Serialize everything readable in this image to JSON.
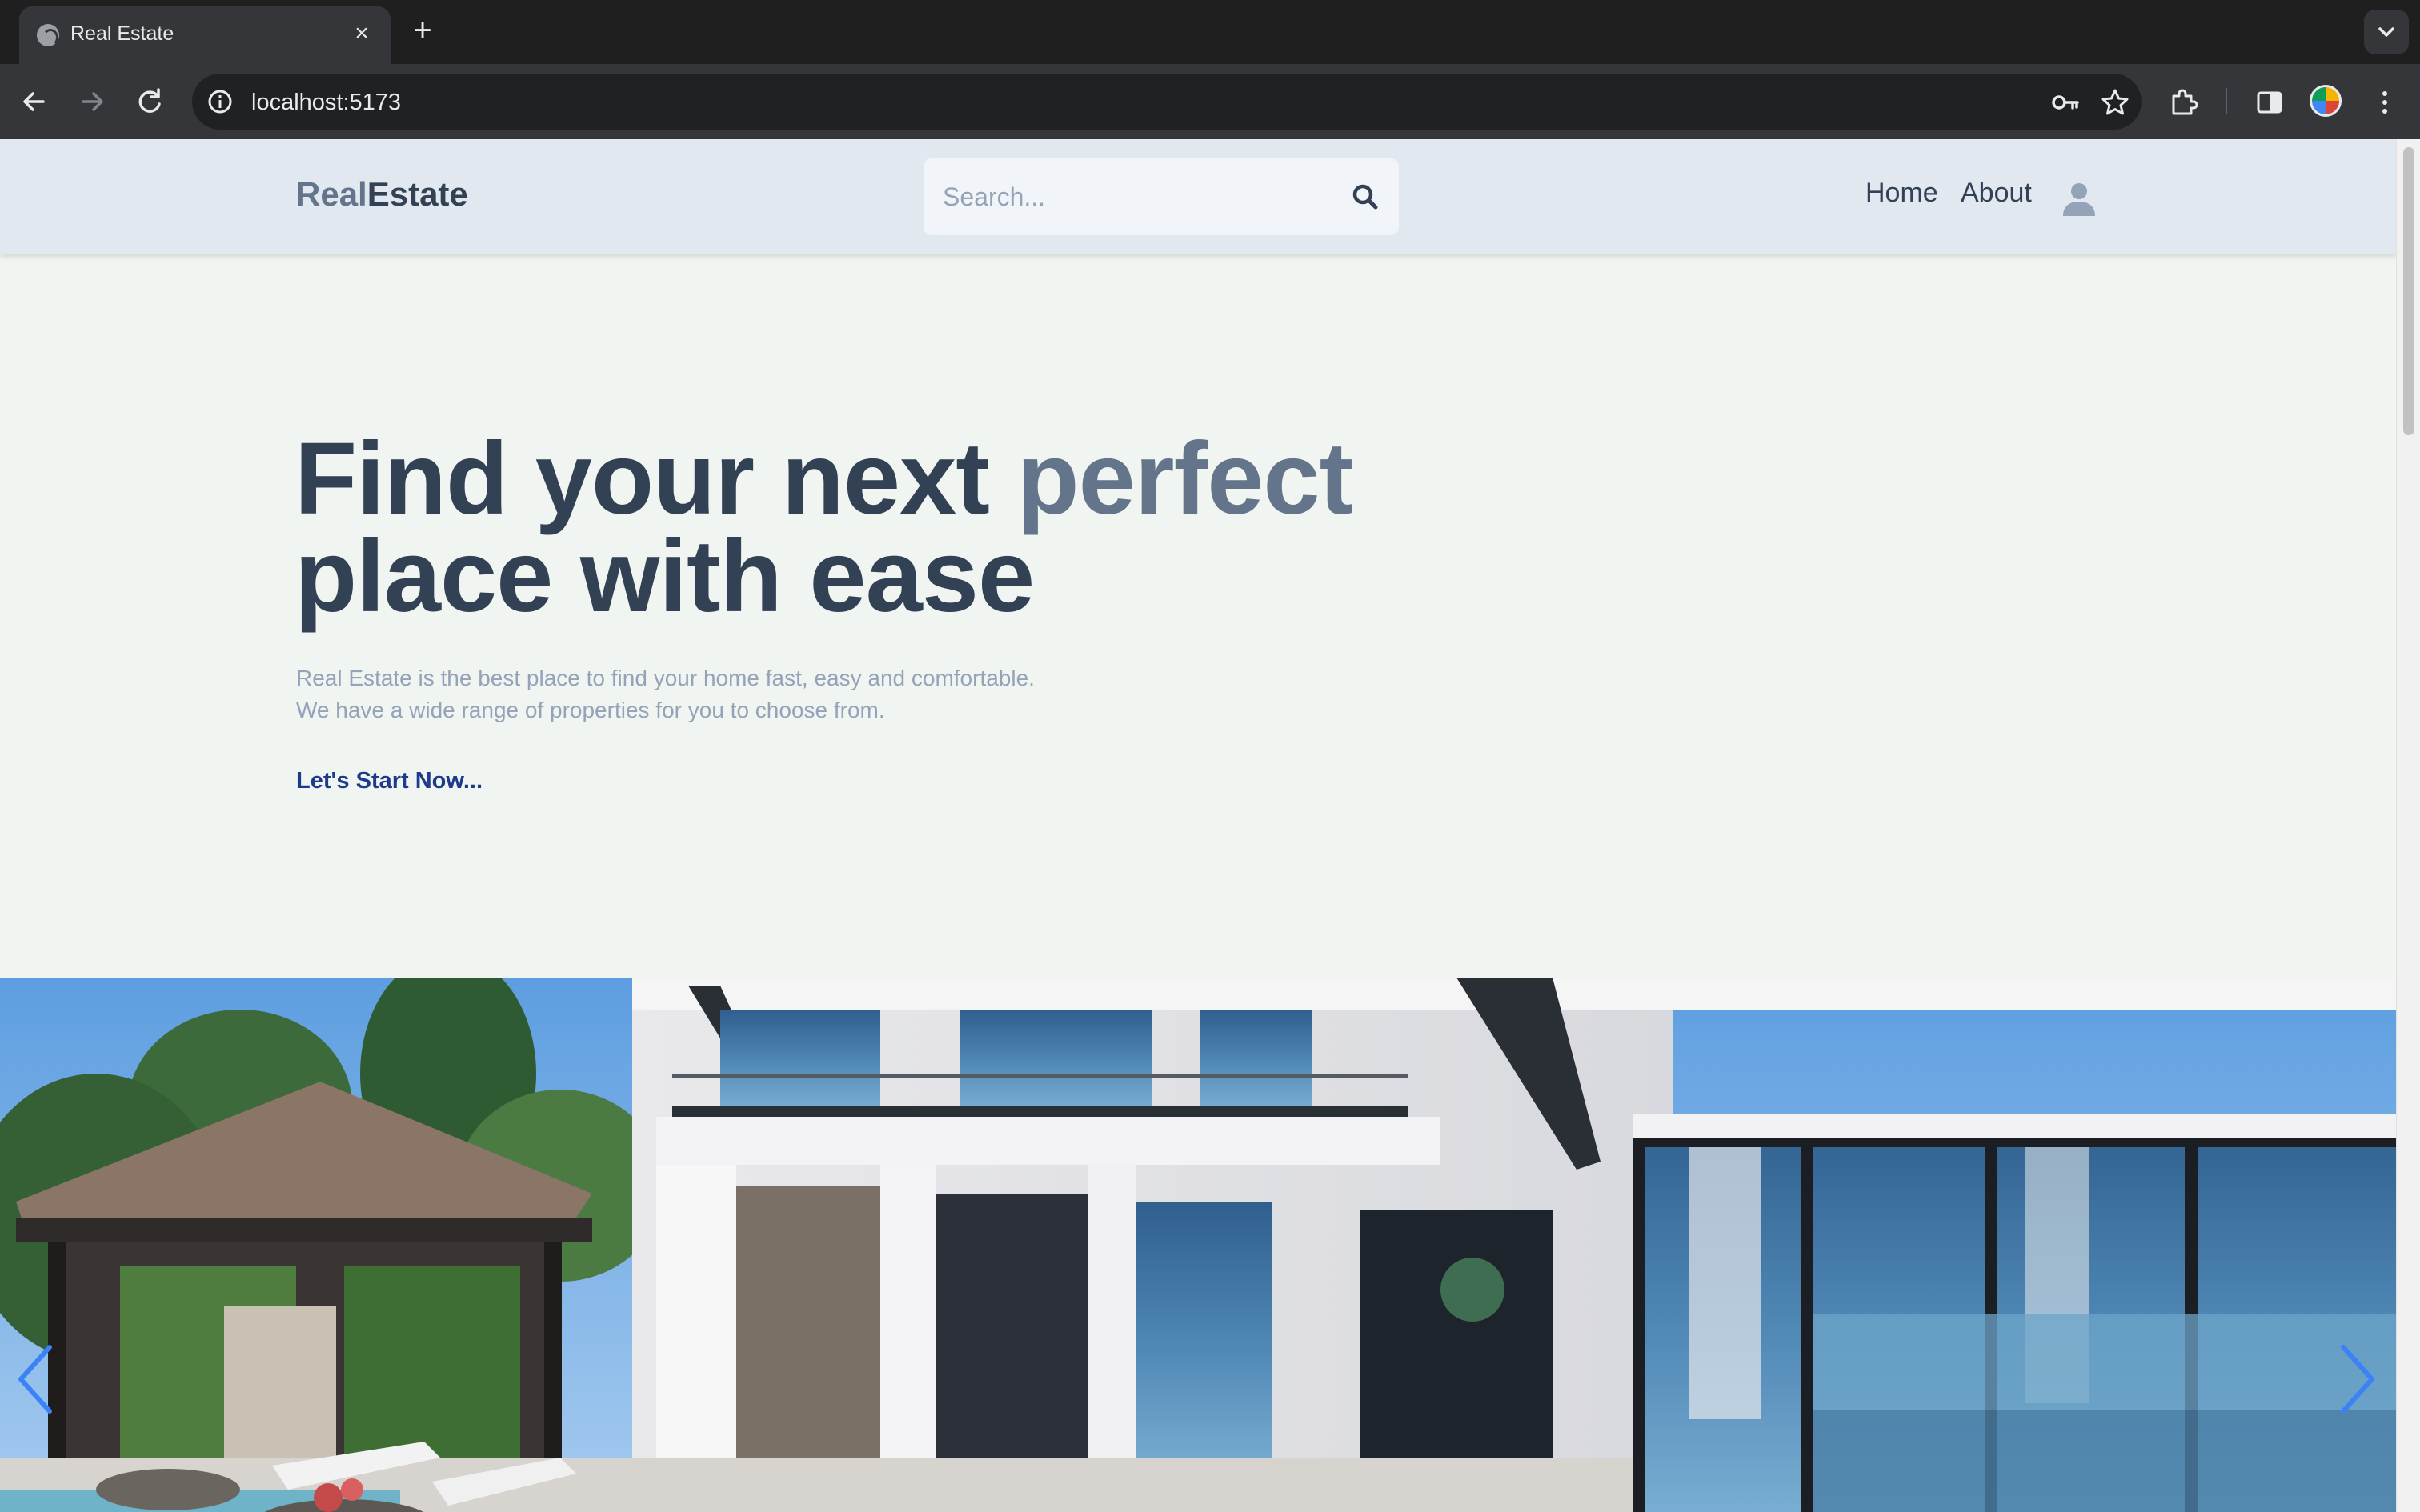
{
  "browser": {
    "tab_title": "Real Estate",
    "url": "localhost:5173"
  },
  "header": {
    "logo_part1": "Real",
    "logo_part2": "Estate",
    "search_placeholder": "Search...",
    "nav": {
      "home": "Home",
      "about": "About"
    }
  },
  "hero": {
    "title_part1": "Find your next ",
    "title_accent": "perfect",
    "title_part2": "place with ease",
    "desc_line1": "Real Estate is the best place to find your home fast, easy and comfortable.",
    "desc_line2": "We have a wide range of properties for you to choose from.",
    "cta": "Let's Start Now..."
  },
  "colors": {
    "logo_light": "#64748b",
    "logo_dark": "#334155",
    "cta": "#1e3a8a",
    "header_bg": "#e2e8f0",
    "page_bg": "#f1f5f1",
    "slider_arrow": "#3b82f6"
  },
  "icons": {
    "search": "search-icon",
    "avatar": "user-avatar-icon",
    "prev": "chevron-left-icon",
    "next": "chevron-right-icon"
  }
}
